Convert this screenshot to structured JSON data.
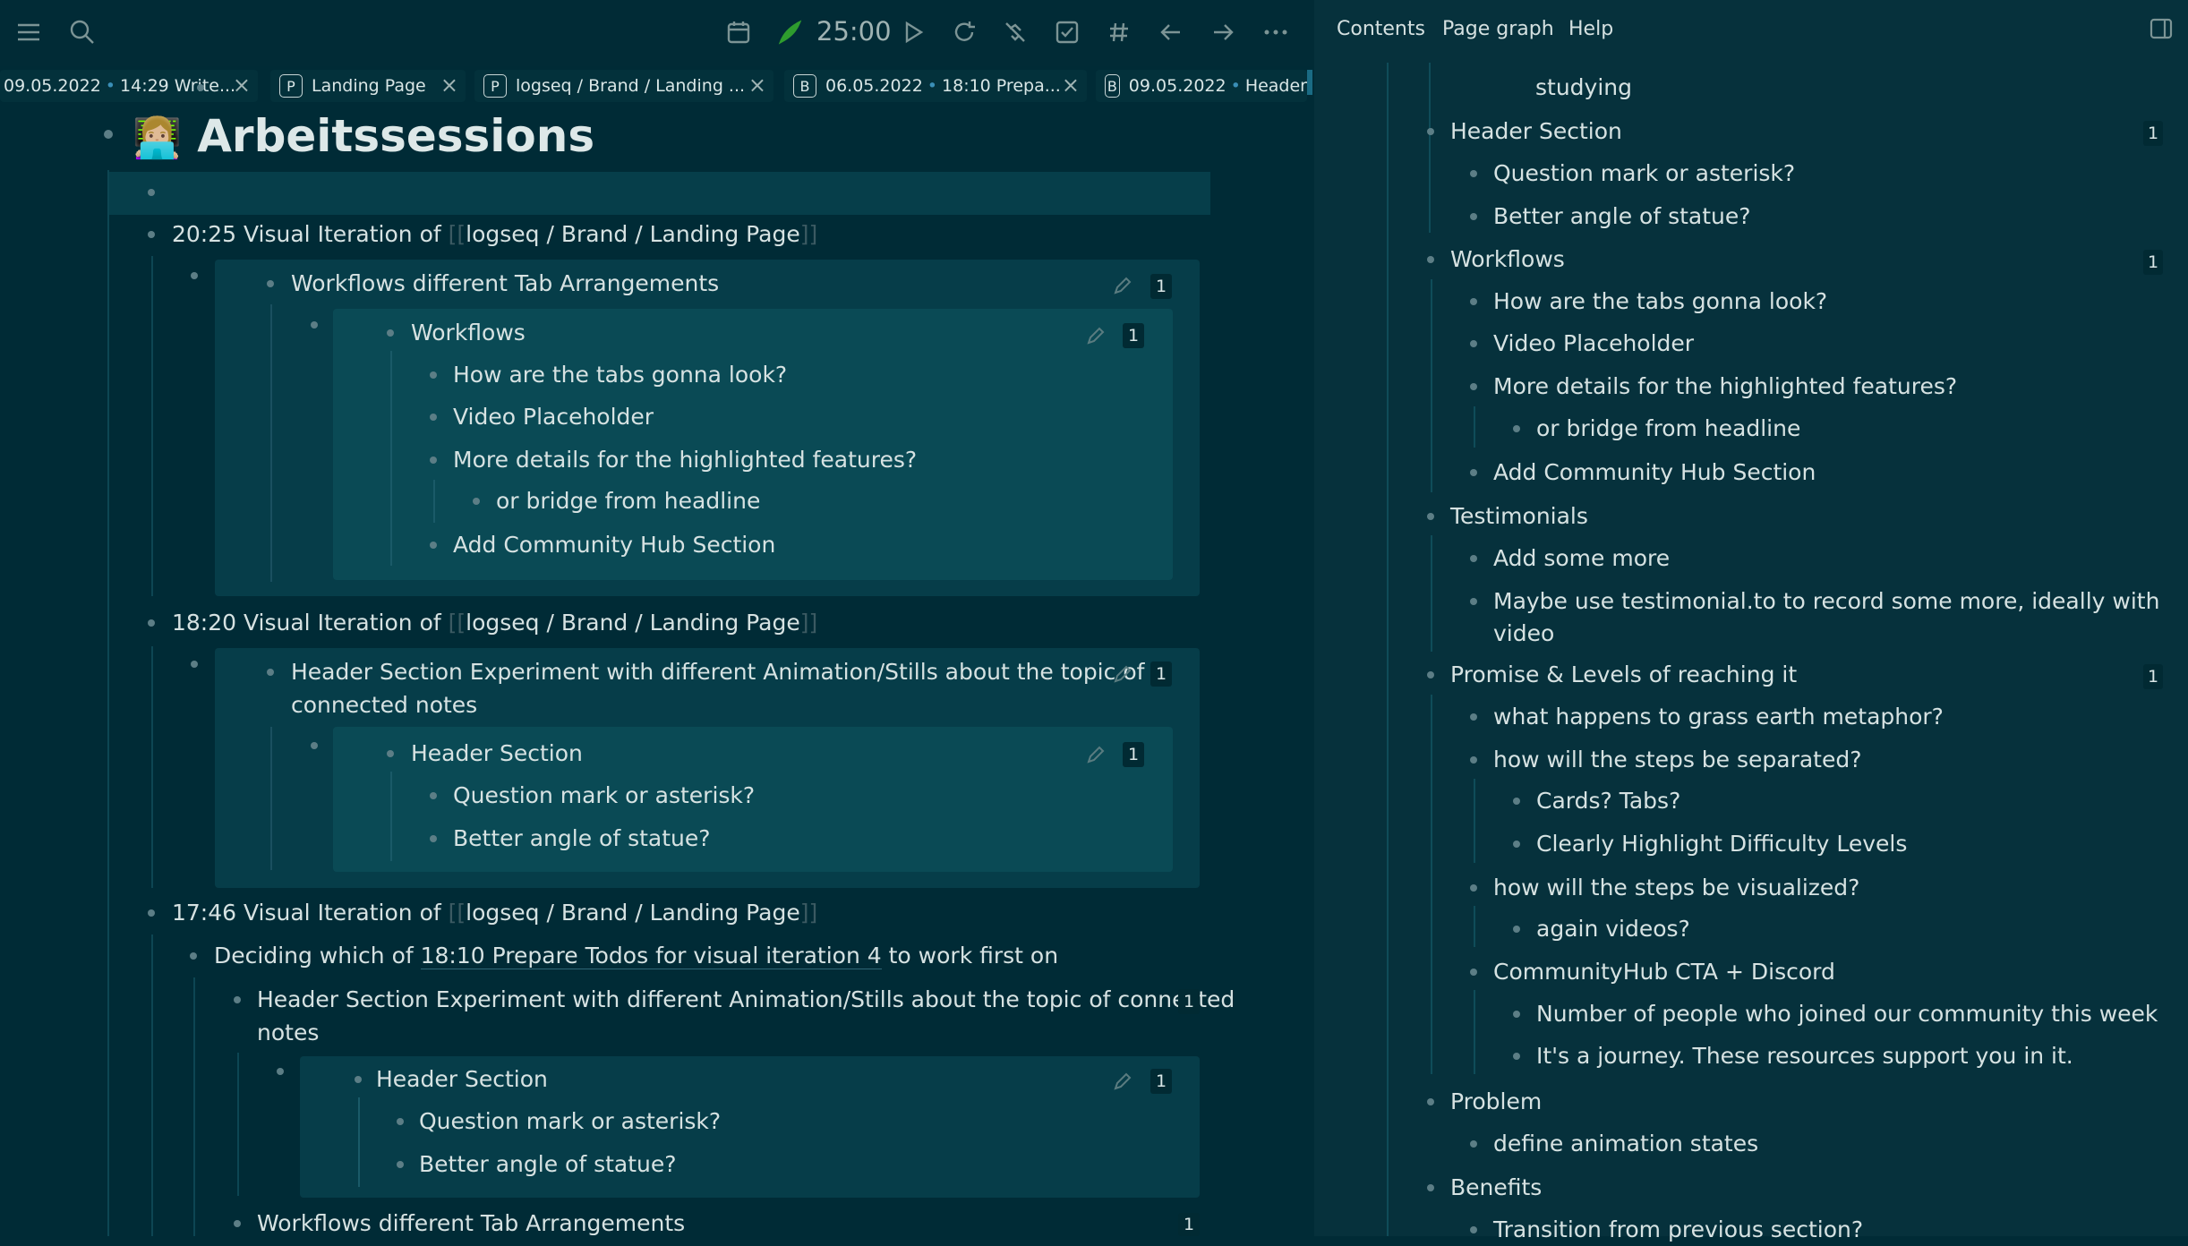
{
  "toolbar": {
    "timer": "25:00",
    "icons": [
      "menu-icon",
      "search-icon",
      "calendar-icon",
      "pomodoro-icon",
      "play-icon",
      "refresh-icon",
      "strikethrough-icon",
      "checkbox-icon",
      "hashtag-icon",
      "back-arrow-icon",
      "forward-arrow-icon",
      "more-icon"
    ]
  },
  "tabs": [
    {
      "badge": "",
      "date": "09.05.2022",
      "title": "14:29 Write..."
    },
    {
      "badge": "P",
      "date": "",
      "title": "Landing Page"
    },
    {
      "badge": "P",
      "date": "",
      "title": "logseq / Brand / Landing ..."
    },
    {
      "badge": "B",
      "date": "06.05.2022",
      "title": "18:10 Prepa..."
    },
    {
      "badge": "B",
      "date": "09.05.2022",
      "title": "Header"
    }
  ],
  "page": {
    "title": "Arbeitssessions",
    "title_emoji": "👩🏼‍💻",
    "blocks": {
      "b1_time": "20:25  Visual Iteration of ",
      "b1_ref": "logseq / Brand / Landing Page",
      "b1_child": "Workflows different Tab Arrangements",
      "b1_child_count": "1",
      "b1_wf": "Workflows",
      "b1_wf_count": "1",
      "b1_items": [
        "How are the tabs gonna look?",
        "Video Placeholder",
        "More details for the highlighted features?"
      ],
      "b1_sub": "or bridge from headline",
      "b1_last": "Add Community Hub Section",
      "b2_time": "18:20 Visual Iteration of ",
      "b2_ref": "logseq / Brand / Landing Page",
      "b2_child_l1": "Header Section Experiment with different Animation/Stills about the topic of",
      "b2_child_l2": "connected notes",
      "b2_child_count": "1",
      "b2_hs": "Header Section",
      "b2_hs_count": "1",
      "b2_items": [
        "Question mark or asterisk?",
        "Better angle of statue?"
      ],
      "b3_time": "17:46 Visual Iteration of ",
      "b3_ref": "logseq / Brand / Landing Page",
      "b3_decide_pre": "Deciding which of ",
      "b3_decide_ref": "18:10 Prepare Todos for visual iteration 4",
      "b3_decide_post": " to work first on",
      "b3_child_l1": "Header Section Experiment with different Animation/Stills about the topic of connected",
      "b3_child_l2": "notes",
      "b3_child_count": "1",
      "b3_hs": "Header Section",
      "b3_hs_count": "1",
      "b3_items": [
        "Question mark or asterisk?",
        "Better angle of statue?"
      ],
      "b3_wf": "Workflows different Tab Arrangements",
      "b3_wf_count": "1"
    }
  },
  "sidebar": {
    "tabs": [
      "Contents",
      "Page graph",
      "Help"
    ],
    "outline": {
      "studying": "studying",
      "header_section": "Header Section",
      "header_count": "1",
      "header_items": [
        "Question mark or asterisk?",
        "Better angle of statue?"
      ],
      "workflows": "Workflows",
      "workflows_count": "1",
      "workflows_items": [
        "How are the tabs gonna look?",
        "Video Placeholder",
        "More details for the highlighted features?"
      ],
      "workflows_sub": "or bridge from headline",
      "workflows_last": "Add Community Hub Section",
      "testimonials": "Testimonials",
      "test_items": [
        "Add some more",
        "Maybe use testimonial.to to record some more, ideally with",
        "video"
      ],
      "promise": "Promise & Levels of reaching it",
      "promise_count": "1",
      "p1": "what happens to grass earth metaphor?",
      "p2": "how will the steps be separated?",
      "p2_sub": [
        "Cards? Tabs?",
        "Clearly Highlight Difficulty Levels"
      ],
      "p3": "how will the steps be visualized?",
      "p3_sub": "again videos?",
      "p4": "CommunityHub CTA + Discord",
      "p4_sub": [
        "Number of people who joined our community this week",
        "It's a journey. These resources support you in it."
      ],
      "problem": "Problem",
      "problem_item": "define animation states",
      "benefits": "Benefits",
      "benefits_item": "Transition from previous section?"
    }
  }
}
